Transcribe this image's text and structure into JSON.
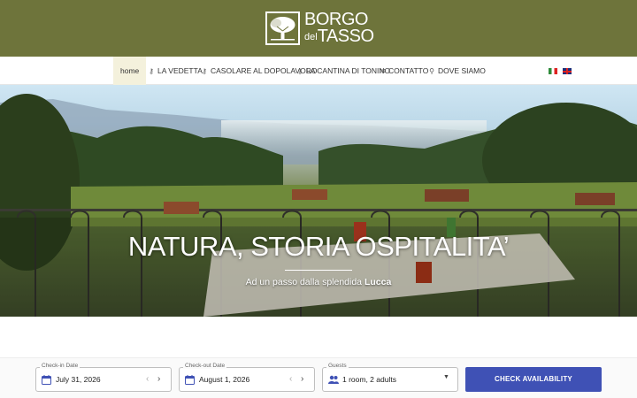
{
  "brand": {
    "line1": "BORGO",
    "line2_small": "del",
    "line2_big": "TASSO",
    "header_color": "#6e743b"
  },
  "nav": {
    "items": [
      {
        "label": "home",
        "icon": "",
        "active": true
      },
      {
        "label": "LA VEDETTA",
        "icon": "key-icon"
      },
      {
        "label": "CASOLARE AL DOPOLAVORO",
        "icon": "key-icon"
      },
      {
        "label": "LA CANTINA DI TONINO",
        "icon": "key-icon"
      },
      {
        "label": "CONTATTO",
        "icon": "envelope-icon"
      },
      {
        "label": "DOVE SIAMO",
        "icon": "map-pin-icon"
      }
    ],
    "languages": [
      "it-flag-icon",
      "en-flag-icon"
    ]
  },
  "hero": {
    "title": "NATURA, STORIA OSPITALITA’",
    "subtitle_prefix": "Ad un passo dalla splendida",
    "subtitle_bold": "Lucca"
  },
  "booking": {
    "checkin": {
      "label": "Check-in Date",
      "value": "July 31, 2026"
    },
    "checkout": {
      "label": "Check-out Date",
      "value": "August 1, 2026"
    },
    "guests": {
      "label": "Guests",
      "value": "1 room, 2 adults"
    },
    "button": "CHECK AVAILABILITY",
    "button_color": "#3f51b5"
  }
}
